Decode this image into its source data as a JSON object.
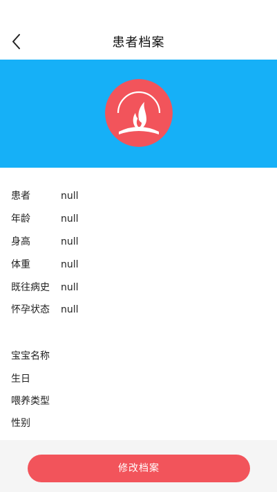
{
  "header": {
    "title": "患者档案",
    "back_icon": "chevron-left-icon"
  },
  "banner": {
    "background_color": "#16b0f7",
    "logo_color": "#f2545b",
    "logo_icon": "flame-logo"
  },
  "patient": {
    "fields": [
      {
        "label": "患者",
        "value": "null"
      },
      {
        "label": "年龄",
        "value": "null"
      },
      {
        "label": "身高",
        "value": "null"
      },
      {
        "label": "体重",
        "value": "null"
      },
      {
        "label": "既往病史",
        "value": "null"
      },
      {
        "label": "怀孕状态",
        "value": "null"
      }
    ]
  },
  "baby": {
    "fields": [
      {
        "label": "宝宝名称",
        "value": ""
      },
      {
        "label": "生日",
        "value": ""
      },
      {
        "label": "喂养类型",
        "value": ""
      },
      {
        "label": "性别",
        "value": ""
      }
    ]
  },
  "footer": {
    "edit_label": "修改档案",
    "button_color": "#f2545b"
  }
}
